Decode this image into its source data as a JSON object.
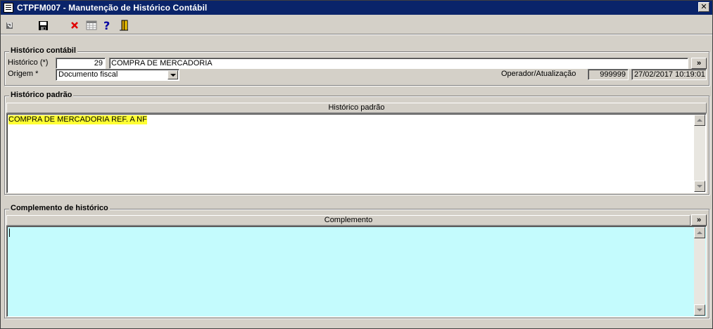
{
  "window": {
    "title": "CTPFM007 - Manutenção de Histórico Contábil",
    "close_glyph": "✕"
  },
  "toolbar": {
    "icons": [
      "back-icon",
      "save-icon",
      "delete-icon",
      "grid-icon",
      "help-icon",
      "exit-door-icon"
    ]
  },
  "historico_contabil": {
    "legend": "Histórico contábil",
    "historico_label": "Histórico (*)",
    "historico_code": "29",
    "historico_desc": "COMPRA DE MERCADORIA",
    "origem_label": "Origem *",
    "origem_value": "Documento fiscal",
    "operador_label": "Operador/Atualização",
    "operador_value": "999999",
    "atualizacao_value": "27/02/2017 10:19:01",
    "expand_glyph": "»"
  },
  "historico_padrao": {
    "legend": "Histórico padrão",
    "column_header": "Histórico padrão",
    "text": "COMPRA DE MERCADORIA REF. A NF"
  },
  "complemento": {
    "legend": "Complemento de histórico",
    "column_header": "Complemento",
    "expand_glyph": "»",
    "text": ""
  },
  "colors": {
    "titlebar": "#0a246a",
    "face": "#d4d0c8",
    "highlight": "#ffff33",
    "complemento_bg": "#c4fbfd"
  }
}
